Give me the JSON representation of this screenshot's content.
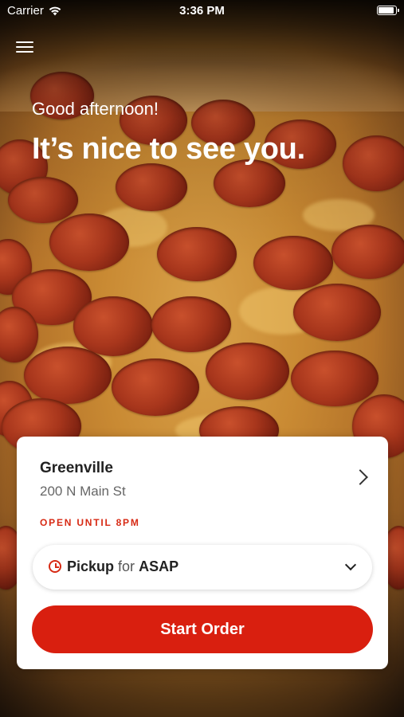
{
  "status_bar": {
    "carrier": "Carrier",
    "time": "3:36 PM"
  },
  "header": {
    "menu_icon": "hamburger-menu-icon"
  },
  "hero": {
    "greeting": "Good afternoon!",
    "headline": "It’s nice to see you.",
    "background": "pepperoni-pizza-photo"
  },
  "store_card": {
    "name": "Greenville",
    "address": "200 N Main St",
    "status": "OPEN UNTIL 8PM",
    "status_color": "#d72a14",
    "pickup": {
      "method": "Pickup",
      "connector": "for",
      "time": "ASAP"
    },
    "start_button": "Start Order",
    "accent": "#d91f0f"
  }
}
